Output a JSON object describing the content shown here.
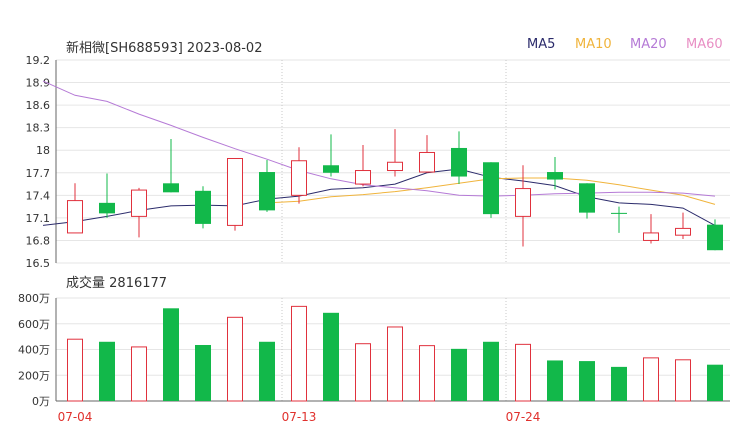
{
  "header": {
    "title": "新相微[SH688593] 2023-08-02",
    "legend": [
      {
        "label": "MA5",
        "color": "#2b2b6b"
      },
      {
        "label": "MA10",
        "color": "#f0b43c"
      },
      {
        "label": "MA20",
        "color": "#b57ad6"
      },
      {
        "label": "MA60",
        "color": "#e88fc4"
      }
    ]
  },
  "volume_header": {
    "label": "成交量",
    "value": "2816177"
  },
  "colors": {
    "up": "#e0313d",
    "down": "#12b84a",
    "grid": "#e6e6e6",
    "axis": "#666666",
    "date": "#e0312d"
  },
  "chart_data": [
    {
      "type": "candlestick",
      "title": "新相微[SH688593] 2023-08-02",
      "ylim": [
        16.5,
        19.2
      ],
      "yticks": [
        19.2,
        18.9,
        18.6,
        18.3,
        18.0,
        17.7,
        17.4,
        17.1,
        16.8,
        16.5
      ],
      "ytick_labels": [
        "19.2",
        "18.9",
        "18.6",
        "18.3",
        "18",
        "17.7",
        "17.4",
        "17.1",
        "16.8",
        "16.5"
      ],
      "x_labels": [
        {
          "index": 0,
          "label": "07-04"
        },
        {
          "index": 7,
          "label": "07-13"
        },
        {
          "index": 14,
          "label": "07-24"
        }
      ],
      "candles": [
        {
          "open": 16.9,
          "close": 17.33,
          "high": 17.56,
          "low": 16.9
        },
        {
          "open": 17.3,
          "close": 17.16,
          "high": 17.69,
          "low": 17.1
        },
        {
          "open": 17.12,
          "close": 17.47,
          "high": 17.5,
          "low": 16.84
        },
        {
          "open": 17.56,
          "close": 17.44,
          "high": 18.15,
          "low": 17.44
        },
        {
          "open": 17.46,
          "close": 17.02,
          "high": 17.52,
          "low": 16.96
        },
        {
          "open": 17.0,
          "close": 17.89,
          "high": 17.89,
          "low": 16.93
        },
        {
          "open": 17.71,
          "close": 17.2,
          "high": 17.87,
          "low": 17.18
        },
        {
          "open": 17.4,
          "close": 17.86,
          "high": 18.04,
          "low": 17.29
        },
        {
          "open": 17.8,
          "close": 17.7,
          "high": 18.21,
          "low": 17.65
        },
        {
          "open": 17.55,
          "close": 17.73,
          "high": 18.07,
          "low": 17.52
        },
        {
          "open": 17.73,
          "close": 17.84,
          "high": 18.28,
          "low": 17.65
        },
        {
          "open": 17.71,
          "close": 17.97,
          "high": 18.2,
          "low": 17.7
        },
        {
          "open": 18.03,
          "close": 17.65,
          "high": 18.25,
          "low": 17.55
        },
        {
          "open": 17.84,
          "close": 17.15,
          "high": 17.84,
          "low": 17.1
        },
        {
          "open": 17.12,
          "close": 17.49,
          "high": 17.8,
          "low": 16.72
        },
        {
          "open": 17.71,
          "close": 17.61,
          "high": 17.91,
          "low": 17.48
        },
        {
          "open": 17.56,
          "close": 17.17,
          "high": 17.56,
          "low": 17.09
        },
        {
          "open": 17.16,
          "close": 17.16,
          "high": 17.25,
          "low": 16.9
        },
        {
          "open": 16.8,
          "close": 16.9,
          "high": 17.15,
          "low": 16.76
        },
        {
          "open": 16.87,
          "close": 16.96,
          "high": 17.17,
          "low": 16.82
        },
        {
          "open": 17.01,
          "close": 16.67,
          "high": 17.08,
          "low": 16.67
        }
      ],
      "series": [
        {
          "name": "MA5",
          "color": "#2b2b6b",
          "values": [
            17.0,
            17.05,
            17.12,
            17.2,
            17.26,
            17.27,
            17.26,
            17.35,
            17.39,
            17.48,
            17.5,
            17.55,
            17.7,
            17.75,
            17.64,
            17.59,
            17.53,
            17.38,
            17.3,
            17.28,
            17.23,
            17.0
          ]
        },
        {
          "name": "MA10",
          "color": "#f0b43c",
          "values": [
            null,
            null,
            null,
            null,
            null,
            null,
            null,
            17.3,
            17.32,
            17.38,
            17.41,
            17.45,
            17.5,
            17.56,
            17.62,
            17.63,
            17.63,
            17.6,
            17.54,
            17.47,
            17.4,
            17.28
          ]
        },
        {
          "name": "MA20",
          "color": "#b57ad6",
          "values": [
            18.92,
            18.73,
            18.65,
            18.48,
            18.33,
            18.17,
            18.02,
            17.88,
            17.73,
            17.62,
            17.54,
            17.5,
            17.46,
            17.4,
            17.39,
            17.4,
            17.42,
            17.43,
            17.44,
            17.44,
            17.43,
            17.39
          ]
        },
        {
          "name": "MA60",
          "color": "#e88fc4",
          "values": []
        }
      ]
    },
    {
      "type": "bar",
      "title": "成交量 2816177",
      "ylim": [
        0,
        800
      ],
      "yticks": [
        0,
        200,
        400,
        600,
        800
      ],
      "ytick_labels": [
        "0万",
        "200万",
        "400万",
        "600万",
        "800万"
      ],
      "unit": "万",
      "values": [
        480,
        460,
        420,
        720,
        435,
        650,
        460,
        735,
        685,
        445,
        575,
        430,
        405,
        460,
        440,
        315,
        310,
        265,
        335,
        320,
        282
      ]
    }
  ]
}
